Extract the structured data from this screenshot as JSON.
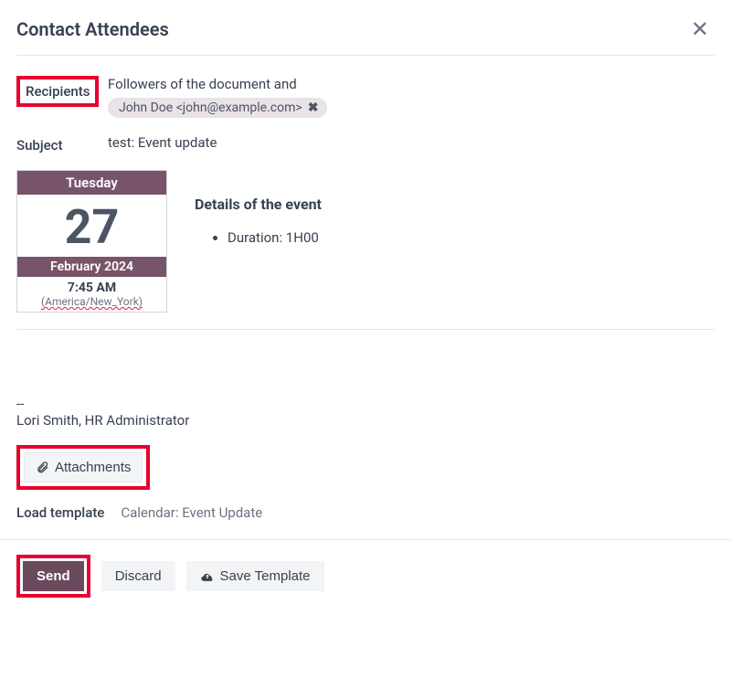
{
  "dialog": {
    "title": "Contact Attendees"
  },
  "recipients": {
    "label": "Recipients",
    "intro": "Followers of the document and",
    "tag": "John Doe <john@example.com>"
  },
  "subject": {
    "label": "Subject",
    "value": "test: Event update"
  },
  "calendar": {
    "weekday": "Tuesday",
    "day": "27",
    "month_year": "February 2024",
    "time": "7:45 AM",
    "timezone": "(America/New_York)"
  },
  "event": {
    "heading": "Details of the event",
    "duration_label": "Duration: 1H00"
  },
  "signature": {
    "dashes": "--",
    "line": "Lori Smith, HR Administrator"
  },
  "attachments": {
    "label": "Attachments"
  },
  "load_template": {
    "label": "Load template",
    "value": "Calendar: Event Update"
  },
  "buttons": {
    "send": "Send",
    "discard": "Discard",
    "save_template": "Save Template"
  }
}
